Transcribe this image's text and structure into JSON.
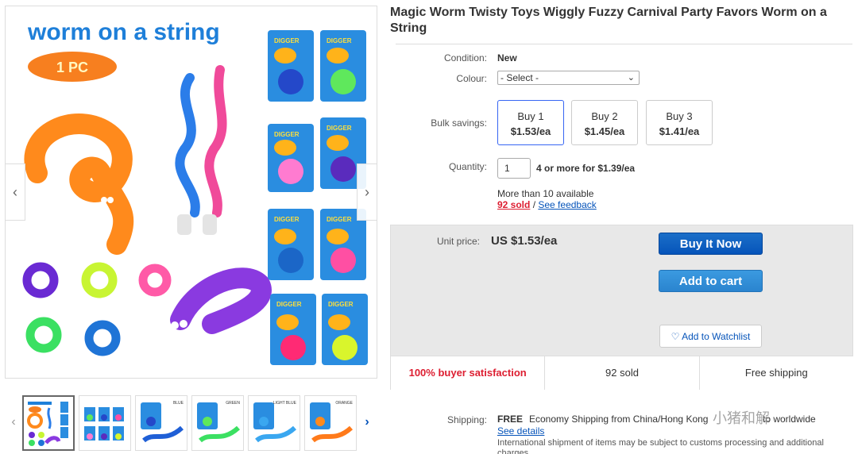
{
  "listing": {
    "title": "Magic Worm Twisty Toys Wiggly Fuzzy Carnival Party Favors Worm on a String"
  },
  "gallery": {
    "main_image_heading": "worm on a string",
    "main_image_badge": "1 PC",
    "card_text": "DIGGER",
    "thumbnail_tags": [
      "",
      "",
      "BLUE",
      "GREEN",
      "LIGHT BLUE",
      "ORANGE"
    ],
    "prev_symbol": "‹",
    "next_symbol": "›"
  },
  "details": {
    "condition_label": "Condition:",
    "condition_value": "New",
    "colour_label": "Colour:",
    "colour_selected": "- Select -",
    "bulk_label": "Bulk savings:",
    "bulk_options": [
      {
        "qty": "Buy 1",
        "price": "$1.53/ea"
      },
      {
        "qty": "Buy 2",
        "price": "$1.45/ea"
      },
      {
        "qty": "Buy 3",
        "price": "$1.41/ea"
      }
    ],
    "quantity_label": "Quantity:",
    "quantity_value": "1",
    "quantity_offer": "4 or more for $1.39/ea",
    "availability": "More than 10 available",
    "sold_link": "92 sold",
    "separator": " / ",
    "feedback_link": "See feedback"
  },
  "purchase": {
    "unit_price_label": "Unit price:",
    "unit_price_value": "US $1.53/ea",
    "buy_now": "Buy It Now",
    "add_to_cart": "Add to cart",
    "watchlist": "Add to Watchlist",
    "watchlist_icon": "♡"
  },
  "stats": {
    "satisfaction": "100% buyer satisfaction",
    "sold": "92 sold",
    "shipping": "Free shipping"
  },
  "shipping": {
    "label": "Shipping:",
    "price": "FREE",
    "method": "Economy Shipping from China/Hong Kong",
    "method_tail": "to worldwide",
    "details_link": "See details",
    "note": "International shipment of items may be subject to customs processing and additional charges."
  },
  "watermark": "小猪和解",
  "colors": {
    "link": "#0654ba",
    "buy_now": "#0654ba",
    "add_to_cart": "#2a84cf",
    "satisfaction": "#dd1e31",
    "panel": "#e8e8e8"
  }
}
